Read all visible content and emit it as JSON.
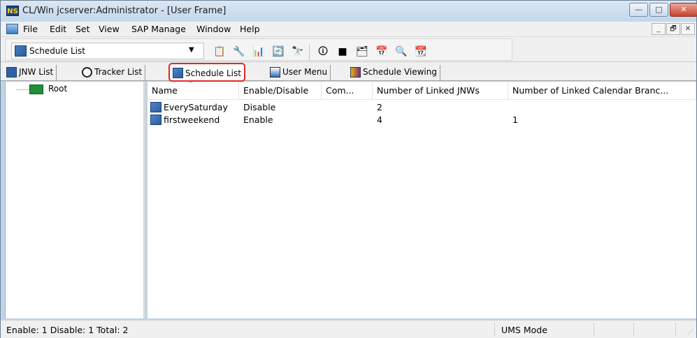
{
  "window": {
    "title": "CL/Win jcserver:Administrator - [User Frame]",
    "app_icon_text": "NS",
    "min_label": "—",
    "max_label": "□",
    "close_label": "✕"
  },
  "menubar": {
    "items": [
      "File",
      "Edit",
      "Set",
      "View",
      "SAP Manage",
      "Window",
      "Help"
    ],
    "mdi_min": "_",
    "mdi_restore": "🗗",
    "mdi_close": "✕"
  },
  "toolbar": {
    "combo_value": "Schedule List",
    "combo_arrow": "▼",
    "icons": {
      "b1": "📋",
      "b2": "🔧",
      "b3": "📊",
      "b4": "🔄",
      "b5": "🔭",
      "b6": "🛈",
      "b7": "■",
      "b8": "🗂",
      "b9": "📅",
      "b10": "🔍",
      "b11": "📆"
    }
  },
  "tabs": {
    "items": [
      "JNW List",
      "Tracker List",
      "Schedule List",
      "User Menu",
      "Schedule Viewing"
    ],
    "selected": "Schedule List"
  },
  "tree": {
    "root_label": "Root"
  },
  "list": {
    "columns": [
      "Name",
      "Enable/Disable",
      "Com...",
      "Number of Linked JNWs",
      "Number of Linked Calendar Branc..."
    ],
    "sort_arrow": "^",
    "rows": [
      {
        "name": "EverySaturday",
        "status": "Disable",
        "comment": "",
        "jnws": "2",
        "calendars": ""
      },
      {
        "name": "firstweekend",
        "status": "Enable",
        "comment": "",
        "jnws": "4",
        "calendars": "1"
      }
    ]
  },
  "statusbar": {
    "summary": "Enable: 1   Disable: 1   Total: 2",
    "mode": "UMS Mode",
    "grip": "⋰"
  },
  "colors": {
    "selected_tab_highlight": "#e52626",
    "title_bar": "#c3d6ec",
    "close_button": "#c8412c"
  }
}
